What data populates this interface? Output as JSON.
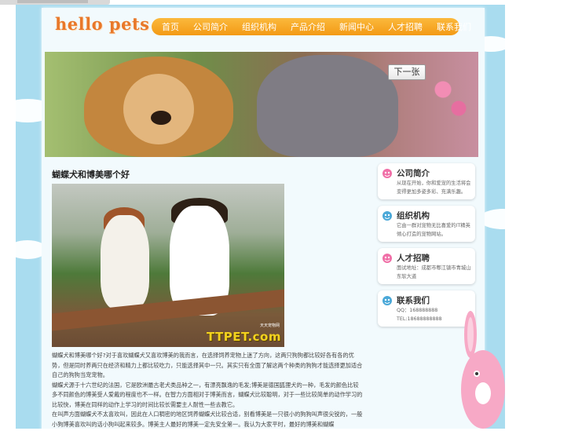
{
  "site": {
    "logo": "hello pets"
  },
  "nav": {
    "items": [
      "首页",
      "公司简介",
      "组织机构",
      "产品介绍",
      "新闻中心",
      "人才招聘",
      "联系我们"
    ]
  },
  "banner": {
    "next_label": "下一张"
  },
  "article": {
    "title": "蝴蝶犬和博美哪个好",
    "photo_watermark": "TTPET.com",
    "photo_watermark_sub": "天天宠物网",
    "paragraphs": [
      "蝴蝶犬和博美哪个好?对于喜欢蝴蝶犬又喜欢博美的我而言，在选择饲养宠物上迷了方向，这两只狗狗都比较好各有各的优势，但是同时养两只在经济和精力上都比较吃力，只能选择其中一只。其实只有全面了解这两个种类的狗狗才能选择更加适合自己的狗狗当宠宠物。",
      "蝴蝶犬源于十六世纪的法国，它是欧洲最古老犬类品种之一，有漂亮飘逸的毛发;博美是德国狐狸犬的一种，毛发的颜色比较多不同颜色的博美受人爱戴的程度也不一样。在智力方面相对于博美而言，蝴蝶犬比较聪明，对于一些比较简单的动作学习的比较快，博美在同样的动作上学习的时间比较长需要主人耐性一些去教它。",
      "在叫声方面蝴蝶犬不太喜欢叫，因此在人口稠密的地区饲养蝴蝶犬比较合适，别看博美是一只很小的狗狗叫声很尖锐的，一般小狗博美喜欢叫的话小狗叫起来较多。博美主人最好的博美一定先安全第一。我认为大家平时，最好的博美和蝴蝶"
    ]
  },
  "sidebar": {
    "cards": [
      {
        "title": "公司简介",
        "text": "从现在开始，你和爱宠的生活将会变得更加多姿多彩、充满乐趣。",
        "icon": "pet-icon"
      },
      {
        "title": "组织机构",
        "text": "它由一群对宠物无比喜爱的IT精英倾心打造的宠物网站。",
        "icon": "pet-icon"
      },
      {
        "title": "人才招聘",
        "text": "面试地址：成都市郫江镇市青城山东软大道",
        "icon": "pet-icon"
      },
      {
        "title": "联系我们",
        "text": "QQ：168888888\nTEL:18688888888",
        "icon": "pet-icon"
      }
    ]
  },
  "colors": {
    "nav_orange": "#f5a623",
    "logo_orange": "#e8782a",
    "sky_blue": "#a9dcef"
  }
}
